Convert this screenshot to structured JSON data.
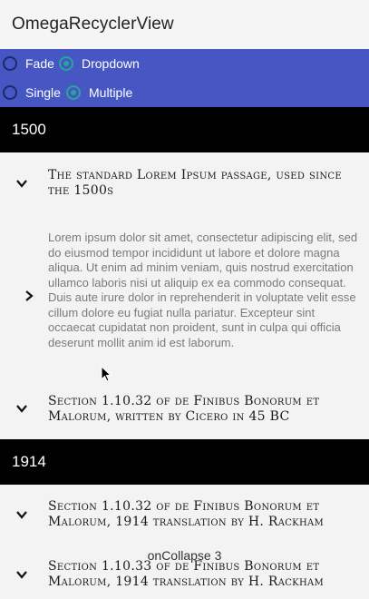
{
  "app": {
    "title": "OmegaRecyclerView"
  },
  "options": {
    "row1": [
      {
        "label": "Fade",
        "checked": false
      },
      {
        "label": "Dropdown",
        "checked": true
      }
    ],
    "row2": [
      {
        "label": "Single",
        "checked": false
      },
      {
        "label": "Multiple",
        "checked": true
      }
    ]
  },
  "sections": [
    {
      "header": "1500",
      "items": [
        {
          "title": "The standard Lorem Ipsum passage, used since the 1500s",
          "expanded": true,
          "body": "Lorem ipsum dolor sit amet, consectetur adipiscing elit, sed do eiusmod tempor incididunt ut labore et dolore magna aliqua. Ut enim ad minim veniam, quis nostrud exercitation ullamco laboris nisi ut aliquip ex ea commodo consequat. Duis aute irure dolor in reprehenderit in voluptate velit esse cillum dolore eu fugiat nulla pariatur. Excepteur sint occaecat cupidatat non proident, sunt in culpa qui officia deserunt mollit anim id est laborum."
        },
        {
          "title": "Section 1.10.32 of de Finibus Bonorum et Malorum, written by Cicero in 45 BC",
          "expanded": false
        }
      ]
    },
    {
      "header": "1914",
      "items": [
        {
          "title": "Section 1.10.32 of de Finibus Bonorum et Malorum, 1914 translation by H. Rackham",
          "expanded": false
        },
        {
          "title": "Section 1.10.33 of de Finibus Bonorum et Malorum, 1914 translation by H. Rackham",
          "expanded": false
        }
      ]
    }
  ],
  "toast": "onCollapse 3",
  "colors": {
    "options_bg": "#4656c2",
    "radio_checked": "#26a69a",
    "section_header_bg": "#000000"
  }
}
